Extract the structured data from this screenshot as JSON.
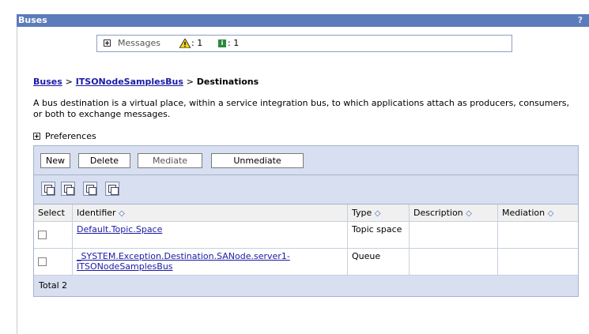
{
  "window": {
    "title": "Buses",
    "help": "?"
  },
  "messages": {
    "label": "Messages",
    "warning_count": ": 1",
    "info_count": ": 1"
  },
  "breadcrumb": {
    "item1": "Buses",
    "item2": "ITSONodeSamplesBus",
    "current": "Destinations",
    "separator": ">"
  },
  "description": "A bus destination is a virtual place, within a service integration bus, to which applications attach as producers, consumers, or both to exchange messages.",
  "preferences": {
    "label": "Preferences"
  },
  "toolbar": {
    "new": "New",
    "delete": "Delete",
    "mediate": "Mediate",
    "unmediate": "Unmediate"
  },
  "table": {
    "columns": {
      "select": "Select",
      "identifier": "Identifier",
      "type": "Type",
      "description": "Description",
      "mediation": "Mediation"
    },
    "sort_glyph": "◇",
    "rows": [
      {
        "identifier": "Default.Topic.Space",
        "type": "Topic space",
        "description": "",
        "mediation": ""
      },
      {
        "identifier": "_SYSTEM.Exception.Destination.SANode.server1-ITSONodeSamplesBus",
        "type": "Queue",
        "description": "",
        "mediation": ""
      }
    ],
    "total": "Total 2"
  },
  "colors": {
    "titlebar": "#5b7bba",
    "panel": "#d7dff0",
    "link": "#1a1aa6"
  }
}
